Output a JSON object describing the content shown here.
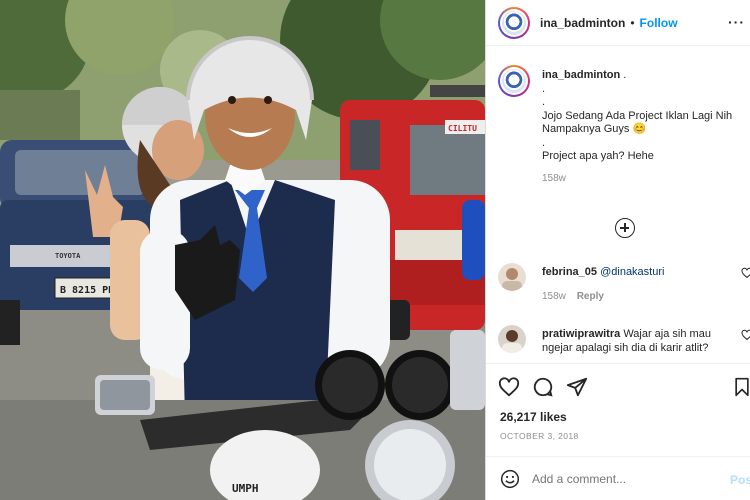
{
  "photo": {
    "plate": "B 8215 PD",
    "car_brand": "TOYOTA",
    "van_sign": "CILITU",
    "bike_brand": "UMPH"
  },
  "post": {
    "username": "ina_badminton",
    "follow_label": "Follow",
    "more_glyph": "···",
    "caption_user": "ina_badminton",
    "caption_lines": [
      ".",
      ".",
      "Jojo Sedang Ada Project Iklan Lagi Nih",
      "Nampaknya Guys 😊",
      ".",
      "Project apa yah? Hehe"
    ],
    "caption_time": "158w",
    "comments": [
      {
        "user": "febrina_05",
        "mention": "@dinakasturi",
        "text": "",
        "time": "158w",
        "reply": "Reply"
      },
      {
        "user": "pratiwiprawitra",
        "mention": "",
        "text": "Wajar aja sih mau ngejar apalagi sih dia di karir atlit?",
        "time": "",
        "reply": ""
      }
    ],
    "likes": "26,217 likes",
    "date": "OCTOBER 3, 2018",
    "add_comment_placeholder": "Add a comment...",
    "post_label": "Post"
  },
  "colors": {
    "accent": "#0095f6",
    "post_disabled": "#b2dffc",
    "text": "#262626",
    "muted": "#8e8e8e"
  },
  "icons": [
    "heart-icon",
    "comment-icon",
    "share-icon",
    "bookmark-icon",
    "emoji-icon",
    "plus-circle-icon",
    "more-icon"
  ]
}
